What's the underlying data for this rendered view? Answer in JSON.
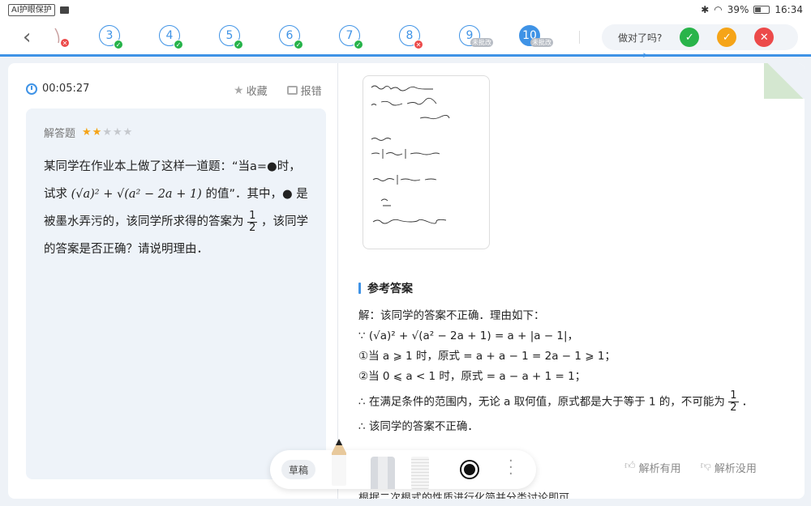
{
  "status_bar": {
    "eye_badge": "AI护眼保护",
    "battery": "39%",
    "time": "16:34"
  },
  "nav": {
    "questions": [
      {
        "number": "3",
        "status": "correct",
        "tag": ""
      },
      {
        "number": "4",
        "status": "correct",
        "tag": ""
      },
      {
        "number": "5",
        "status": "correct",
        "tag": ""
      },
      {
        "number": "6",
        "status": "correct",
        "tag": ""
      },
      {
        "number": "7",
        "status": "correct",
        "tag": ""
      },
      {
        "number": "8",
        "status": "wrong",
        "tag": ""
      },
      {
        "number": "9",
        "status": "unmarked",
        "tag": "未批改"
      },
      {
        "number": "10",
        "status": "current",
        "tag": "未批改"
      }
    ],
    "judge_label": "做对了吗?",
    "judge_icons": [
      "check-icon",
      "half-check-icon",
      "cross-icon"
    ]
  },
  "question": {
    "timer": "00:05:27",
    "favorite_label": "收藏",
    "report_label": "报错",
    "type_label": "解答题",
    "difficulty": 2,
    "difficulty_max": 5,
    "text_1": "某同学在作业本上做了这样一道题：“当a=●时，试求",
    "formula": "(√a)² + √(a² − 2a + 1)",
    "text_2": "的值”．其中，● 是被墨水弄污的，该同学所求得的答案为",
    "answer_num": "1",
    "answer_den": "2",
    "text_3": "，该同学的答案是否正确？请说明理由．"
  },
  "answer": {
    "heading": "参考答案",
    "lines": [
      "解：该同学的答案不正确．理由如下：",
      "∵ (√a)² + √(a² − 2a + 1) = a + |a − 1|，",
      "①当 a ⩾ 1 时，原式 = a + a − 1 = 2a − 1 ⩾ 1；",
      "②当 0 ⩽ a < 1 时，原式 = a − a + 1 = 1；"
    ],
    "line5_text": "∴ 在满足条件的范围内，无论 a 取何值，原式都是大于等于 1 的，不可能为",
    "line5_num": "1",
    "line5_den": "2",
    "line5_end": "．",
    "line6": "∴ 该同学的答案不正确．",
    "useful_label": "解析有用",
    "useless_label": "解析没用",
    "cut_text": "根据二次根式的性质进行化简并分类讨论即可"
  },
  "toolbar": {
    "draft_label": "草稿"
  }
}
